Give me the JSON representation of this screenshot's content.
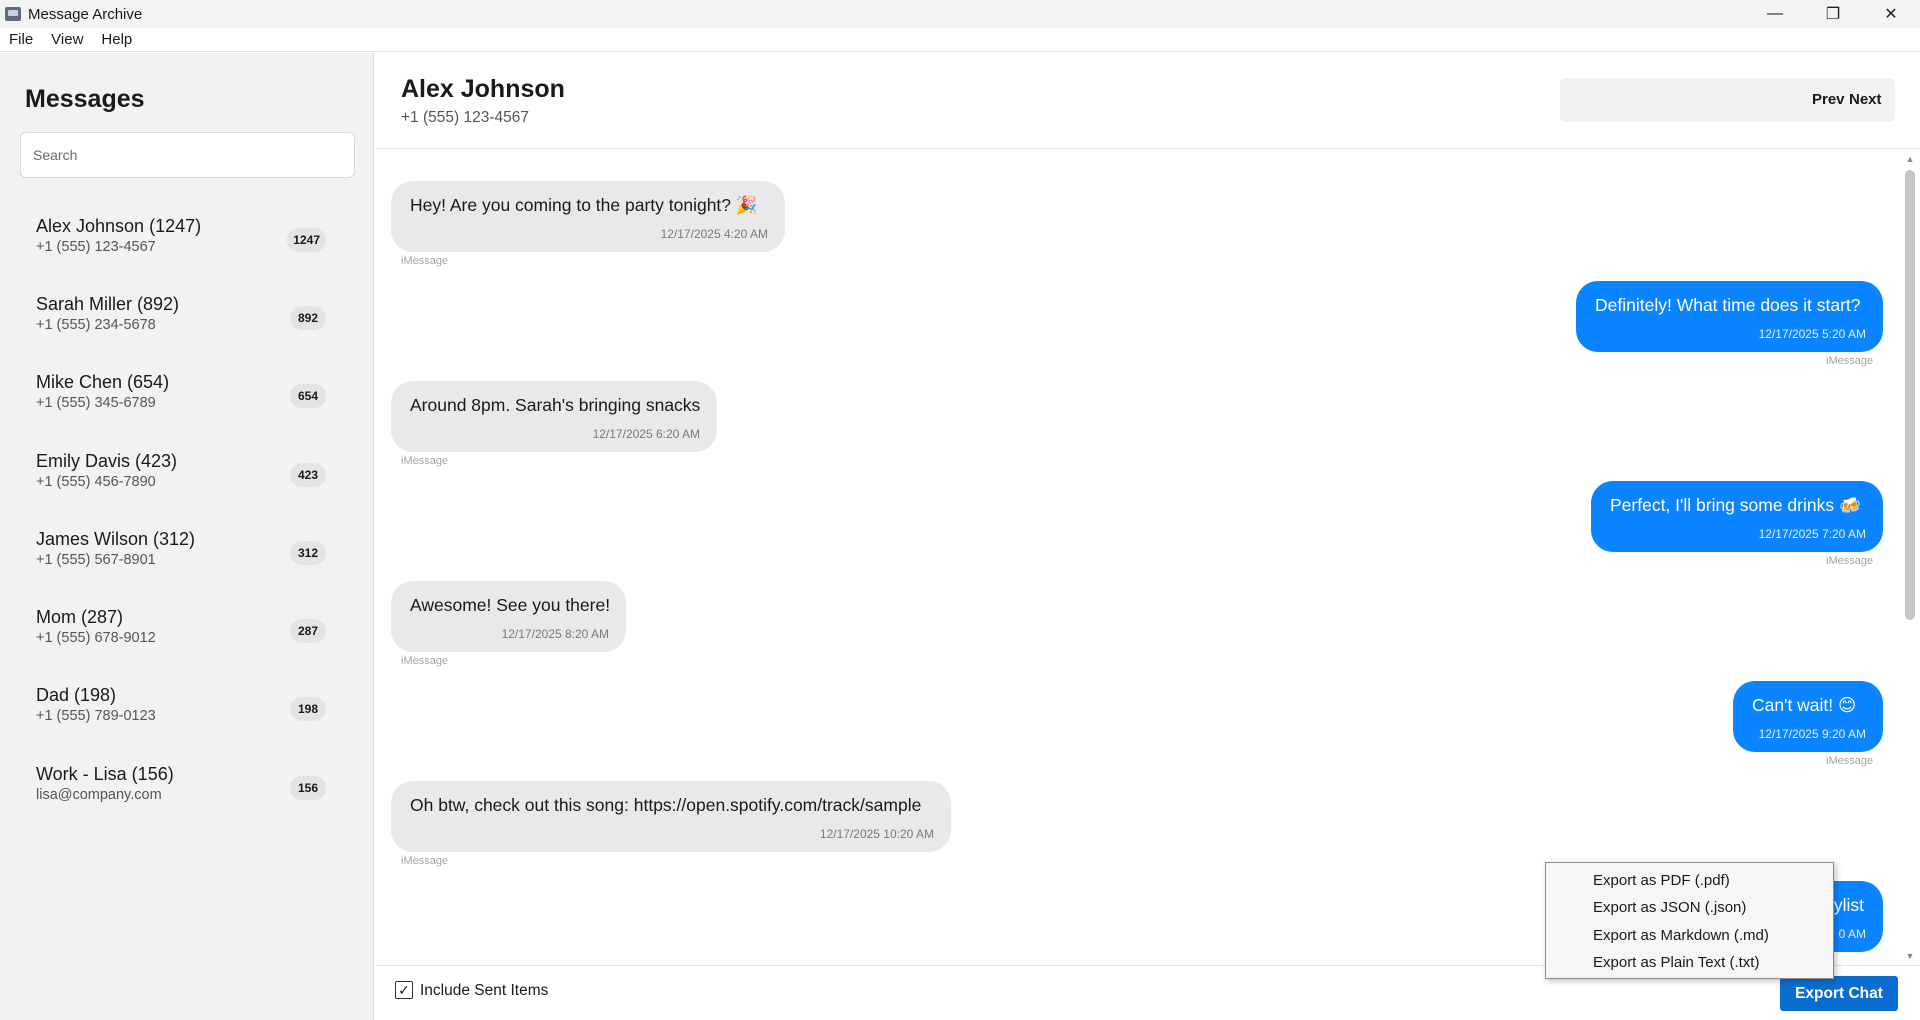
{
  "window": {
    "title": "Message Archive",
    "minimize": "—",
    "maximize": "❐",
    "close": "✕"
  },
  "menu": [
    "File",
    "View",
    "Help"
  ],
  "sidebar": {
    "title": "Messages",
    "search_placeholder": "Search",
    "contacts": [
      {
        "name": "Alex Johnson (1247)",
        "sub": "+1 (555) 123-4567",
        "count": "1247"
      },
      {
        "name": "Sarah Miller (892)",
        "sub": "+1 (555) 234-5678",
        "count": "892"
      },
      {
        "name": "Mike Chen (654)",
        "sub": "+1 (555) 345-6789",
        "count": "654"
      },
      {
        "name": "Emily Davis (423)",
        "sub": "+1 (555) 456-7890",
        "count": "423"
      },
      {
        "name": "James Wilson (312)",
        "sub": "+1 (555) 567-8901",
        "count": "312"
      },
      {
        "name": "Mom (287)",
        "sub": "+1 (555) 678-9012",
        "count": "287"
      },
      {
        "name": "Dad (198)",
        "sub": "+1 (555) 789-0123",
        "count": "198"
      },
      {
        "name": "Work - Lisa (156)",
        "sub": "lisa@company.com",
        "count": "156"
      }
    ]
  },
  "header": {
    "name": "Alex Johnson",
    "phone": "+1 (555) 123-4567",
    "prev": "Prev",
    "next": "Next"
  },
  "messages": [
    {
      "dir": "in",
      "text": "Hey! Are you coming to the party tonight? 🎉",
      "time": "12/17/2025 4:20 AM",
      "service": "iMessage"
    },
    {
      "dir": "out",
      "text": "Definitely! What time does it start?",
      "time": "12/17/2025 5:20 AM",
      "service": "iMessage"
    },
    {
      "dir": "in",
      "text": "Around 8pm. Sarah's bringing snacks",
      "time": "12/17/2025 6:20 AM",
      "service": "iMessage"
    },
    {
      "dir": "out",
      "text": "Perfect, I'll bring some drinks 🍻",
      "time": "12/17/2025 7:20 AM",
      "service": "iMessage"
    },
    {
      "dir": "in",
      "text": "Awesome! See you there!",
      "time": "12/17/2025 8:20 AM",
      "service": "iMessage"
    },
    {
      "dir": "out",
      "text": "Can't wait! 😊",
      "time": "12/17/2025 9:20 AM",
      "service": "iMessage"
    },
    {
      "dir": "in",
      "text": "Oh btw, check out this song: https://open.spotify.com/track/sample",
      "time": "12/17/2025 10:20 AM",
      "service": "iMessage"
    },
    {
      "dir": "out",
      "text": "ylist",
      "time": "0 AM",
      "service": ""
    }
  ],
  "footer": {
    "include_sent_label": "Include Sent Items",
    "include_sent_checked": true,
    "export_label": "Export Chat"
  },
  "export_menu": [
    "Export as PDF (.pdf)",
    "Export as JSON (.json)",
    "Export as Markdown (.md)",
    "Export as Plain Text (.txt)"
  ],
  "colors": {
    "accent": "#0a84ff",
    "export_button": "#0a6ed1",
    "incoming_bubble": "#e9e9eb"
  }
}
